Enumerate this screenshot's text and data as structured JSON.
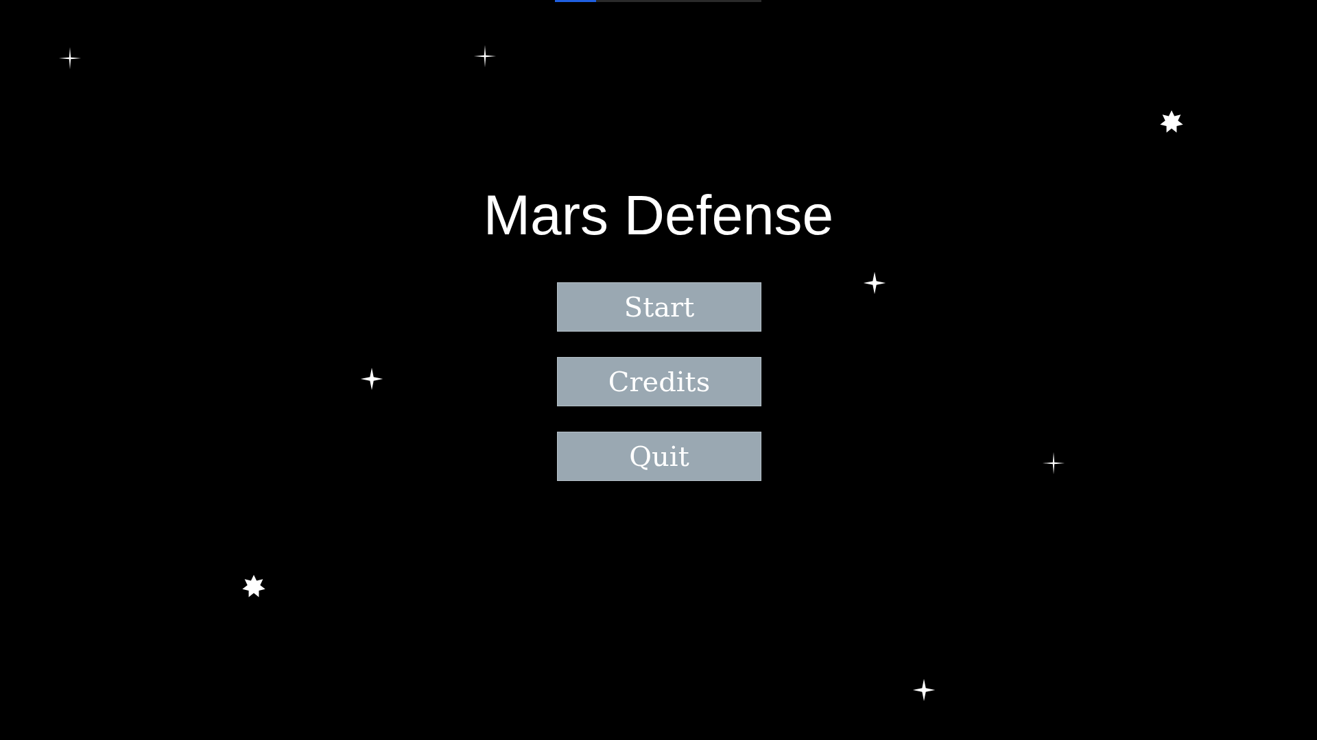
{
  "loading_bar": {
    "level": 0.2
  },
  "title": "Mars Defense",
  "menu": [
    {
      "label": "Start"
    },
    {
      "label": "Credits"
    },
    {
      "label": "Quit"
    }
  ]
}
